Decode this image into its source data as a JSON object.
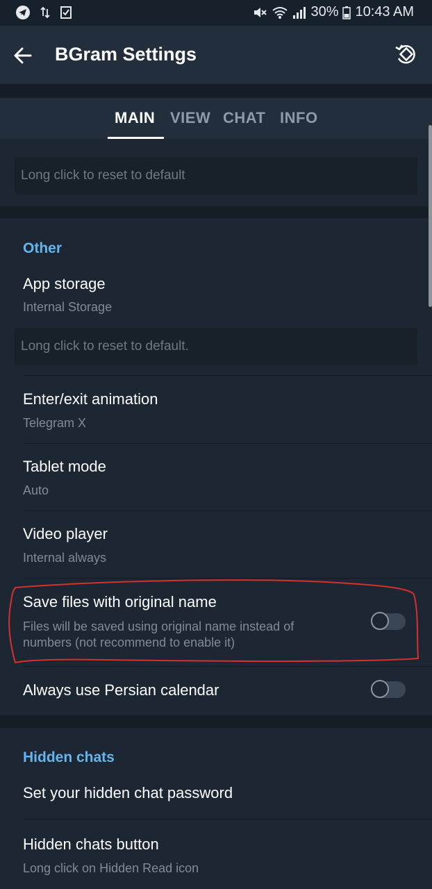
{
  "status_bar": {
    "battery": "30%",
    "time": "10:43 AM",
    "icons": [
      "telegram-icon",
      "data-transfer-icon",
      "task-check-icon",
      "mute-icon",
      "wifi-icon",
      "signal-icon",
      "battery-icon"
    ]
  },
  "header": {
    "title": "BGram Settings",
    "back_icon": "arrow-left-icon",
    "action_icon": "rotate-reset-icon"
  },
  "tabs": [
    {
      "label": "MAIN",
      "active": true
    },
    {
      "label": "VIEW",
      "active": false
    },
    {
      "label": "CHAT",
      "active": false
    },
    {
      "label": "INFO",
      "active": false
    }
  ],
  "top_reset_hint": "Long click to reset to default",
  "other": {
    "header": "Other",
    "app_storage": {
      "title": "App storage",
      "subtitle": "Internal Storage"
    },
    "reset_hint": "Long click to reset to default.",
    "animation": {
      "title": "Enter/exit animation",
      "subtitle": "Telegram X"
    },
    "tablet": {
      "title": "Tablet mode",
      "subtitle": "Auto"
    },
    "video": {
      "title": "Video player",
      "subtitle": "Internal always"
    },
    "save_files": {
      "title": "Save files with original name",
      "subtitle_line1": "Files will be saved using original name instead of",
      "subtitle_line2": "numbers (not recommend to enable it)",
      "enabled": false
    },
    "persian": {
      "title": "Always use Persian calendar",
      "enabled": false
    }
  },
  "hidden": {
    "header": "Hidden chats",
    "password": {
      "title": "Set your hidden chat password"
    },
    "button": {
      "title": "Hidden chats button",
      "subtitle": "Long click on Hidden Read icon"
    }
  },
  "colors": {
    "accent": "#64b5ef",
    "background": "#1d2733",
    "header": "#232e3c",
    "annotation": "#d9302c"
  }
}
